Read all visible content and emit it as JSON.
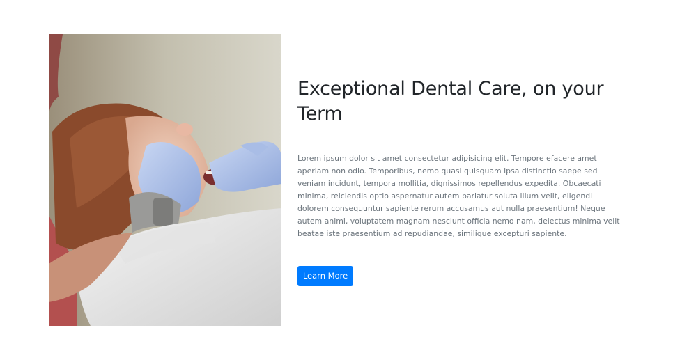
{
  "feature": {
    "image_alt": "Patient receiving dental examination",
    "heading": "Exceptional Dental Care, on your Term",
    "body": "Lorem ipsum dolor sit amet consectetur adipisicing elit. Tempore efacere amet aperiam non odio. Temporibus, nemo quasi quisquam ipsa distinctio saepe sed veniam incidunt, tempora mollitia, dignissimos repellendus expedita. Obcaecati minima, reiciendis optio aspernatur autem pariatur soluta illum velit, eligendi dolorem consequuntur sapiente rerum accusamus aut nulla praesentium! Neque autem animi, voluptatem magnam nesciunt officia nemo nam, delectus minima velit beatae iste praesentium ad repudiandae, similique excepturi sapiente.",
    "button_label": "Learn More"
  },
  "colors": {
    "button_bg": "#007bff",
    "heading": "#212529",
    "body_text": "#6c757d"
  }
}
